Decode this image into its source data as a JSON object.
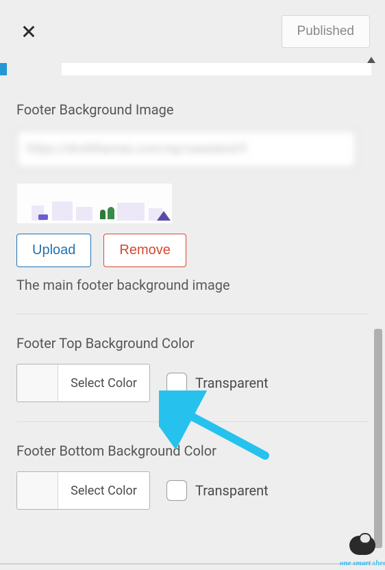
{
  "header": {
    "published_label": "Published"
  },
  "sections": {
    "bg_image": {
      "title": "Footer Background Image",
      "url_value": "https://droitthemes.com/wp/saasland-fi",
      "upload_label": "Upload",
      "remove_label": "Remove",
      "description": "The main footer background image"
    },
    "top_bg_color": {
      "title": "Footer Top Background Color",
      "select_label": "Select Color",
      "transparent_label": "Transparent"
    },
    "bottom_bg_color": {
      "title": "Footer Bottom Background Color",
      "select_label": "Select Color",
      "transparent_label": "Transparent"
    }
  },
  "watermark": {
    "brand": "one smart sheep"
  }
}
